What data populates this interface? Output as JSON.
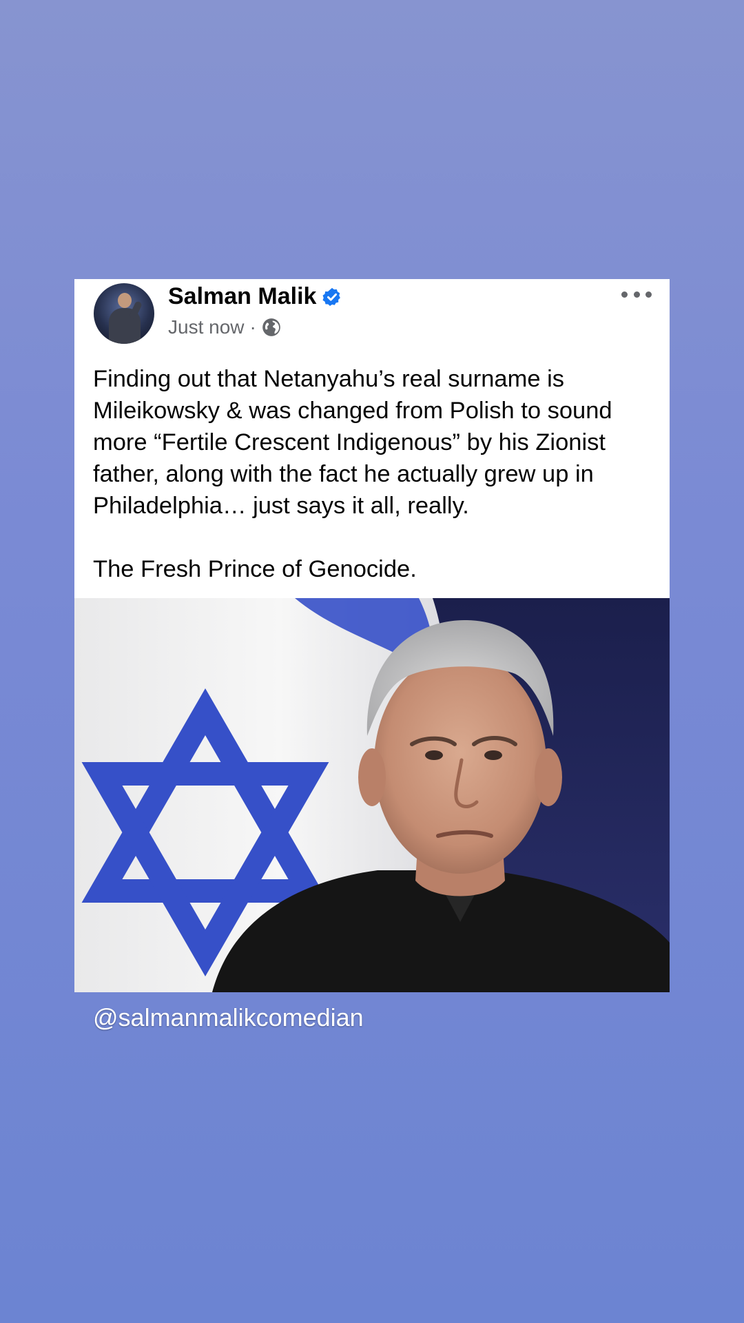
{
  "post": {
    "author_name": "Salman Malik",
    "timestamp": "Just now",
    "separator": "·",
    "paragraphs": [
      "Finding out that Netanyahu’s real surname is Mileikowsky & was changed from Polish to sound more “Fertile Crescent Indigenous” by his Zionist father, along with the fact he actually grew up in Philadelphia… just says it all, really.",
      "The Fresh Prince of Genocide."
    ]
  },
  "icons": {
    "verified": "verified-badge-icon",
    "audience": "globe-icon",
    "more": "more-options-icon"
  },
  "colors": {
    "verified_blue": "#1877f2",
    "flag_blue": "#3650c8",
    "background_top": "#8794d0",
    "background_bottom": "#6c84d2"
  },
  "watermark": {
    "handle": "@salmanmalikcomedian"
  }
}
